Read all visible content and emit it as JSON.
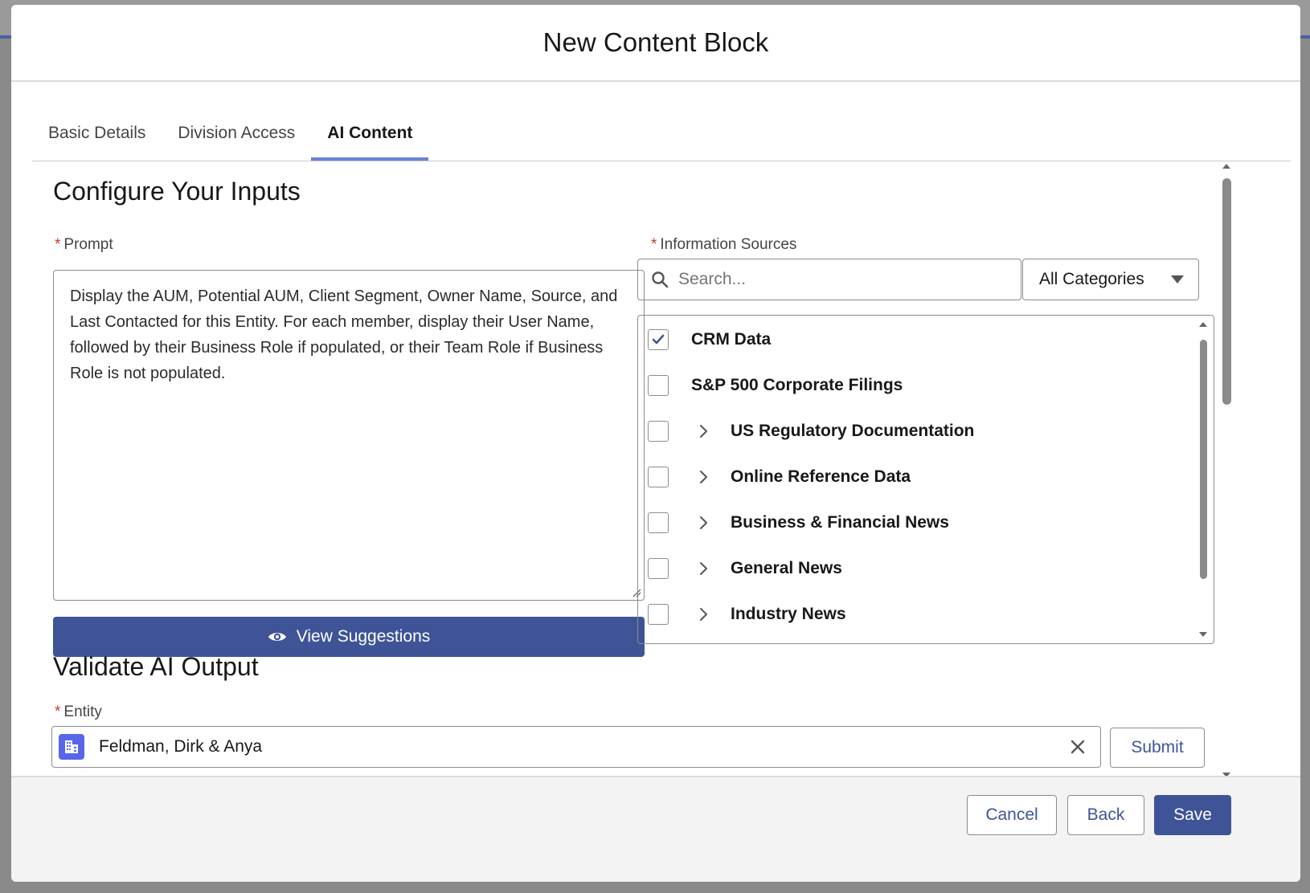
{
  "modal": {
    "title": "New Content Block"
  },
  "tabs": [
    {
      "label": "Basic Details",
      "active": false
    },
    {
      "label": "Division Access",
      "active": false
    },
    {
      "label": "AI Content",
      "active": true
    }
  ],
  "configure": {
    "heading": "Configure Your Inputs",
    "prompt": {
      "required_marker": "*",
      "label": "Prompt",
      "value": "Display the AUM, Potential AUM, Client Segment, Owner Name, Source, and Last Contacted for this Entity. For each member, display their User Name, followed by their Business Role if populated, or their Team Role if Business Role is not populated."
    },
    "view_suggestions_label": "View Suggestions",
    "sources": {
      "required_marker": "*",
      "label": "Information Sources",
      "search_placeholder": "Search...",
      "category_selected": "All Categories",
      "items": [
        {
          "label": "CRM Data",
          "checked": true,
          "expandable": false
        },
        {
          "label": "S&P 500 Corporate Filings",
          "checked": false,
          "expandable": false
        },
        {
          "label": "US Regulatory Documentation",
          "checked": false,
          "expandable": true
        },
        {
          "label": "Online Reference Data",
          "checked": false,
          "expandable": true
        },
        {
          "label": "Business & Financial News",
          "checked": false,
          "expandable": true
        },
        {
          "label": "General News",
          "checked": false,
          "expandable": true
        },
        {
          "label": "Industry News",
          "checked": false,
          "expandable": true
        }
      ]
    }
  },
  "validate": {
    "heading": "Validate AI Output",
    "entity": {
      "required_marker": "*",
      "label": "Entity",
      "value": "Feldman, Dirk & Anya",
      "icon": "building-icon"
    },
    "submit_label": "Submit"
  },
  "footer": {
    "cancel_label": "Cancel",
    "back_label": "Back",
    "save_label": "Save"
  },
  "colors": {
    "brand": "#3e5497",
    "active_tab_underline": "#6b83d6",
    "required": "#c23934",
    "entity_icon": "#5867e8"
  }
}
